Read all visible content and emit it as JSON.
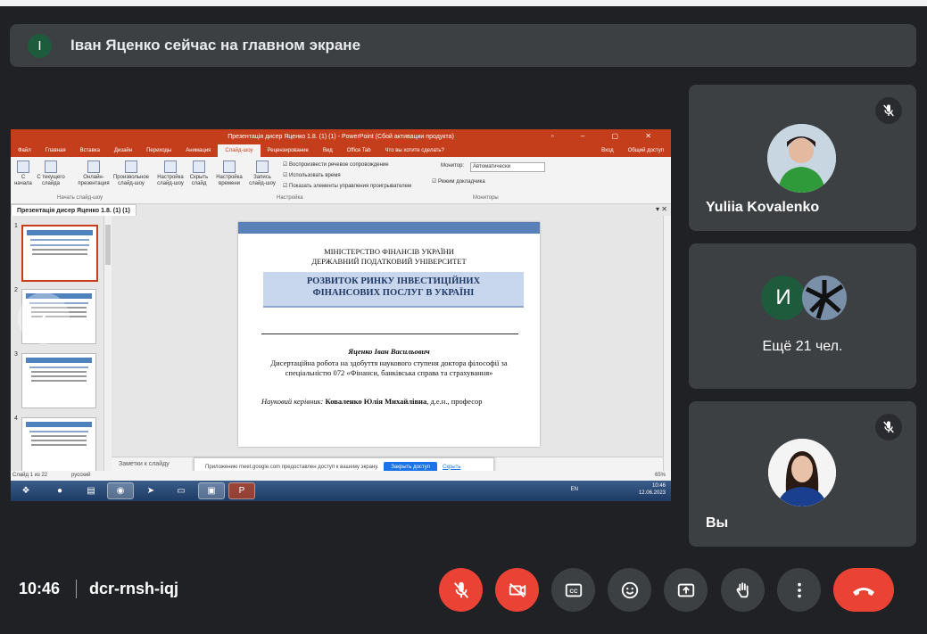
{
  "banner": {
    "avatar_letter": "I",
    "text": "Іван Яценко сейчас на главном экране"
  },
  "presentation": {
    "window_title": "Презентація дисер Яценко 1.8. (1) (1) - PowerPoint (Сбой активации продукта)",
    "ribbon_tabs": [
      "Файл",
      "Главная",
      "Вставка",
      "Дизайн",
      "Переходы",
      "Анимация",
      "Слайд-шоу",
      "Рецензирование",
      "Вид",
      "Office Tab",
      "Что вы хотите сделать?"
    ],
    "ribbon_right": [
      "Вход",
      "Общий доступ"
    ],
    "ribbon_buttons": [
      "С начала",
      "С текущего слайда",
      "Онлайн-презентация",
      "Произвольное слайд-шоу",
      "Настройка слайд-шоу",
      "Скрыть слайд",
      "Настройка времени",
      "Запись слайд-шоу"
    ],
    "ribbon_checks": [
      "Воспроизвести речевое сопровождение",
      "Использовать время",
      "Показать элементы управления проигрывателем"
    ],
    "monitor_label": "Монитор:",
    "monitor_value": "Автоматически",
    "presenter_mode": "Режим докладчика",
    "group_labels": [
      "Начать слайд-шоу",
      "Настройка",
      "Мониторы"
    ],
    "doc_tab": "Презентація дисер Яценко 1.8. (1) (1)",
    "thumb_numbers": [
      "1",
      "2",
      "3",
      "4"
    ],
    "slide": {
      "ministry": "МІНІСТЕРСТВО ФІНАНСІВ УКРАЇНИ",
      "university": "ДЕРЖАВНИЙ ПОДАТКОВИЙ УНІВЕРСИТЕТ",
      "title_line1": "РОЗВИТОК РИНКУ ІНВЕСТИЦІЙНИХ",
      "title_line2": "ФІНАНСОВИХ ПОСЛУГ В УКРАЇНІ",
      "author": "Яценко Іван Васильович",
      "desc_line1": "Дисертаційна робота на здобуття наукового ступеня доктора філософії за",
      "desc_line2": "спеціальністю 072 «Фінанси, банківська справа та страхування»",
      "supervisor_label": "Науковий керівник:",
      "supervisor_name": "Коваленко Юлія Михайлівна",
      "supervisor_rest": ", д.е.н., професор"
    },
    "notes_placeholder": "Заметки к слайду",
    "toast": {
      "text": "Приложению meet.google.com предоставлен доступ к вашему экрану.",
      "stop": "Закрыть доступ",
      "hide": "Скрыть"
    },
    "status": {
      "slide": "Слайд 1 из 22",
      "lang": "русский",
      "zoom": "65%"
    },
    "tray": {
      "lang": "EN",
      "time": "10:46",
      "date": "12.06.2023"
    }
  },
  "participants": [
    {
      "name": "Yuliia Kovalenko",
      "muted": true
    },
    {
      "name": "Ещё 21 чел.",
      "avatar_letter": "И"
    },
    {
      "name": "Вы",
      "muted": true
    }
  ],
  "meeting": {
    "time": "10:46",
    "code": "dcr-rnsh-iqj"
  },
  "colors": {
    "background": "#202124",
    "tile": "#3c4043",
    "red": "#ea4335",
    "powerpoint": "#c43e1c"
  }
}
